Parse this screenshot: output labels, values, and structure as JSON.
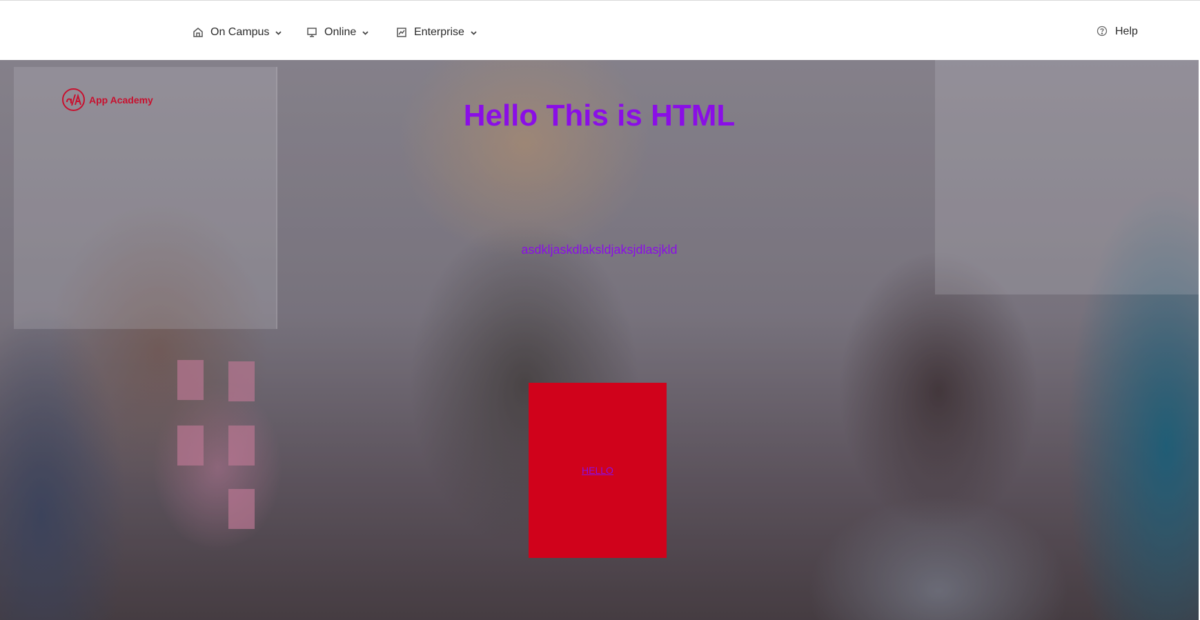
{
  "nav": {
    "items": [
      {
        "label": "On Campus",
        "icon": "home-icon"
      },
      {
        "label": "Online",
        "icon": "monitor-icon"
      },
      {
        "label": "Enterprise",
        "icon": "chart-icon"
      }
    ],
    "help": {
      "label": "Help",
      "icon": "help-circle-icon"
    }
  },
  "logo": {
    "text": "App Academy",
    "mark": "a/A"
  },
  "hero": {
    "title": "Hello This is HTML",
    "text": "asdkljaskdlaksldjaksjdlasjkld",
    "button_label": "HELLO"
  },
  "colors": {
    "accent": "#8a0ee6",
    "brand_red": "#c8102e",
    "cta_red": "#d0021b"
  }
}
